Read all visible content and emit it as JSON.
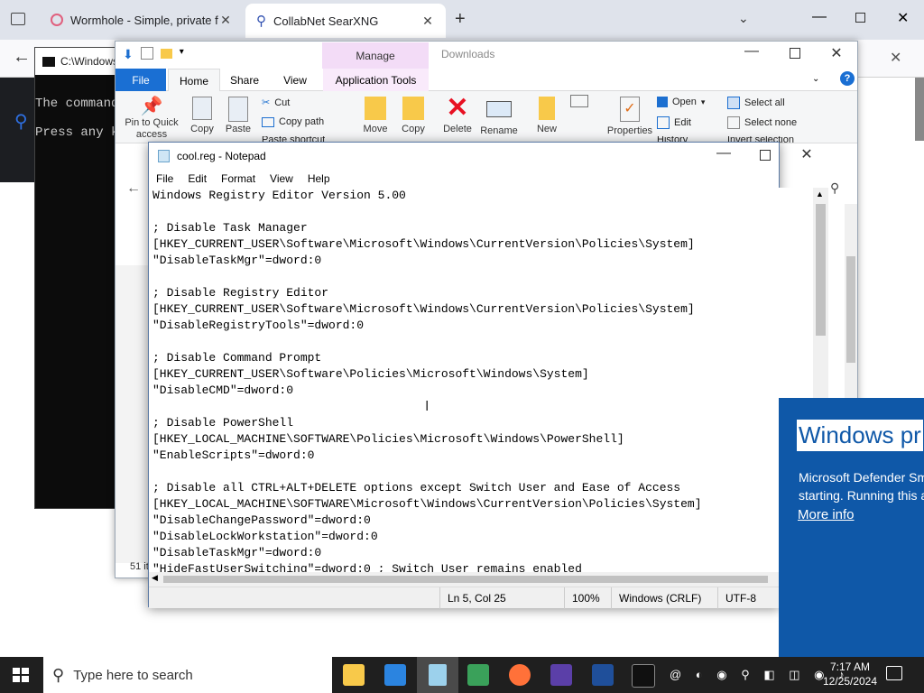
{
  "browser": {
    "tabs": [
      {
        "title": "Wormhole - Simple, private file"
      },
      {
        "title": "CollabNet SearXNG"
      }
    ],
    "new_tab_icon": "plus-icon"
  },
  "cmd": {
    "title": "C:\\Windows",
    "lines": [
      "The command",
      "Press any k"
    ]
  },
  "explorer": {
    "title_context": "Manage",
    "title_tab_inactive": "Downloads",
    "ribbon_tabs": [
      "File",
      "Home",
      "Share",
      "View",
      "Application Tools"
    ],
    "clipboard": {
      "pin": "Pin to Quick access",
      "copy": "Copy",
      "paste": "Paste",
      "cut": "Cut",
      "copy_path": "Copy path",
      "paste_shortcut": "Paste shortcut"
    },
    "organize": {
      "move": "Move",
      "copy": "Copy",
      "delete": "Delete",
      "rename": "Rename"
    },
    "new": {
      "new": "New"
    },
    "open": {
      "properties": "Properties",
      "open": "Open",
      "edit": "Edit",
      "history": "History"
    },
    "select": {
      "select_all": "Select all",
      "select_none": "Select none",
      "invert": "Invert selection"
    },
    "status_items": "51 it"
  },
  "notepad": {
    "title": "cool.reg - Notepad",
    "menu": [
      "File",
      "Edit",
      "Format",
      "View",
      "Help"
    ],
    "content_lines": [
      "Windows Registry Editor Version 5.00",
      "",
      "; Disable Task Manager",
      "[HKEY_CURRENT_USER\\Software\\Microsoft\\Windows\\CurrentVersion\\Policies\\System]",
      "\"DisableTaskMgr\"=dword:0",
      "",
      "; Disable Registry Editor",
      "[HKEY_CURRENT_USER\\Software\\Microsoft\\Windows\\CurrentVersion\\Policies\\System]",
      "\"DisableRegistryTools\"=dword:0",
      "",
      "; Disable Command Prompt",
      "[HKEY_CURRENT_USER\\Software\\Policies\\Microsoft\\Windows\\System]",
      "\"DisableCMD\"=dword:0",
      "",
      "; Disable PowerShell",
      "[HKEY_LOCAL_MACHINE\\SOFTWARE\\Policies\\Microsoft\\Windows\\PowerShell]",
      "\"EnableScripts\"=dword:0",
      "",
      "; Disable all CTRL+ALT+DELETE options except Switch User and Ease of Access",
      "[HKEY_LOCAL_MACHINE\\SOFTWARE\\Microsoft\\Windows\\CurrentVersion\\Policies\\System]",
      "\"DisableChangePassword\"=dword:0",
      "\"DisableLockWorkstation\"=dword:0",
      "\"DisableTaskMgr\"=dword:0",
      "\"HideFastUserSwitching\"=dword:0 ; Switch User remains enabled"
    ],
    "status": {
      "position": "Ln 5, Col 25",
      "zoom": "100%",
      "eol": "Windows (CRLF)",
      "encoding": "UTF-8"
    }
  },
  "defender": {
    "heading": "Windows pr",
    "body_1": "Microsoft Defender Sm",
    "body_2": "starting. Running this a",
    "link": "More info"
  },
  "taskbar": {
    "search_placeholder": "Type here to search",
    "time": "7:17 AM",
    "date": "12/25/2024"
  },
  "colors": {
    "accent": "#0067c0",
    "defender_blue": "#0f58a8",
    "delete_red": "#e81123"
  }
}
